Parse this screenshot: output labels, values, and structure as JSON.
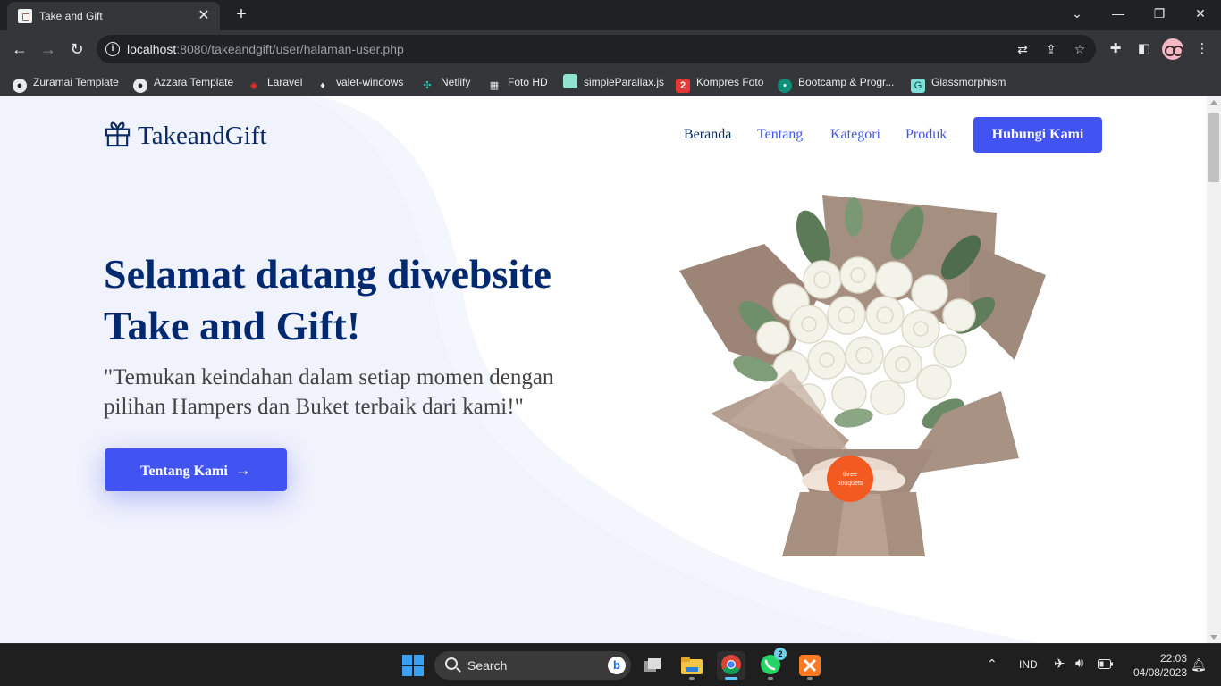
{
  "browser": {
    "tab_title": "Take and Gift",
    "tab_close": "✕",
    "new_tab": "+",
    "url_host": "localhost",
    "url_rest": ":8080/takeandgift/user/halaman-user.php",
    "window_controls": {
      "dropdown": "⌄",
      "minimize": "—",
      "restore": "❐",
      "close": "✕"
    },
    "bookmarks": [
      {
        "label": "Zuramai Template",
        "icon": "github-icon"
      },
      {
        "label": "Azzara Template",
        "icon": "github-icon"
      },
      {
        "label": "Laravel",
        "icon": "laravel-icon"
      },
      {
        "label": "valet-windows",
        "icon": "valet-icon"
      },
      {
        "label": "Netlify",
        "icon": "netlify-icon"
      },
      {
        "label": "Foto HD",
        "icon": "foto-icon"
      },
      {
        "label": "simpleParallax.js",
        "icon": "parallax-icon"
      },
      {
        "label": "Kompres Foto",
        "icon": "kompres-icon"
      },
      {
        "label": "Bootcamp & Progr...",
        "icon": "bootcamp-icon"
      },
      {
        "label": "Glassmorphism",
        "icon": "glass-icon"
      }
    ]
  },
  "site": {
    "brand": "TakeandGift",
    "nav": [
      "Beranda",
      "Tentang",
      "Kategori",
      "Produk"
    ],
    "cta": "Hubungi Kami",
    "hero_title_line1": "Selamat datang diwebsite",
    "hero_title_line2": "Take and Gift!",
    "hero_sub_line1": "\"Temukan keindahan dalam setiap momen dengan",
    "hero_sub_line2": "pilihan Hampers dan Buket terbaik dari kami!\"",
    "hero_button": "Tentang Kami",
    "tag_text_1": "three",
    "tag_text_2": "bouquets",
    "colors": {
      "primary": "#4154f1",
      "navy": "#012970",
      "blob": "#f4f6fd"
    }
  },
  "taskbar": {
    "search_label": "Search",
    "whatsapp_badge": "2",
    "language": "IND",
    "time": "22:03",
    "date": "04/08/2023"
  }
}
